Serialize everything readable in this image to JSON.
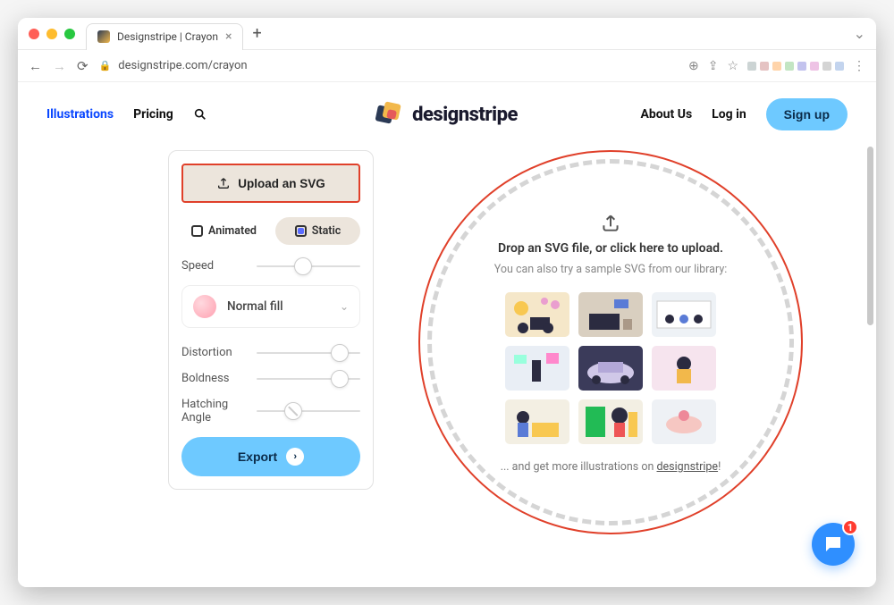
{
  "browser": {
    "tab_title": "Designstripe | Crayon",
    "url": "designstripe.com/crayon"
  },
  "nav": {
    "illustrations": "Illustrations",
    "pricing": "Pricing",
    "brand": "designstripe",
    "about": "About Us",
    "login": "Log in",
    "signup": "Sign up"
  },
  "panel": {
    "upload_label": "Upload an SVG",
    "animated": "Animated",
    "static": "Static",
    "speed": "Speed",
    "fill_label": "Normal fill",
    "distortion": "Distortion",
    "boldness": "Boldness",
    "hatching": "Hatching Angle",
    "export": "Export"
  },
  "dropzone": {
    "title": "Drop an SVG file, or click here to upload.",
    "subtitle": "You can also try a sample SVG from our library:",
    "footer_prefix": "... and get more illustrations on ",
    "footer_link": "designstripe",
    "footer_suffix": "!"
  },
  "chat": {
    "badge": "1"
  }
}
